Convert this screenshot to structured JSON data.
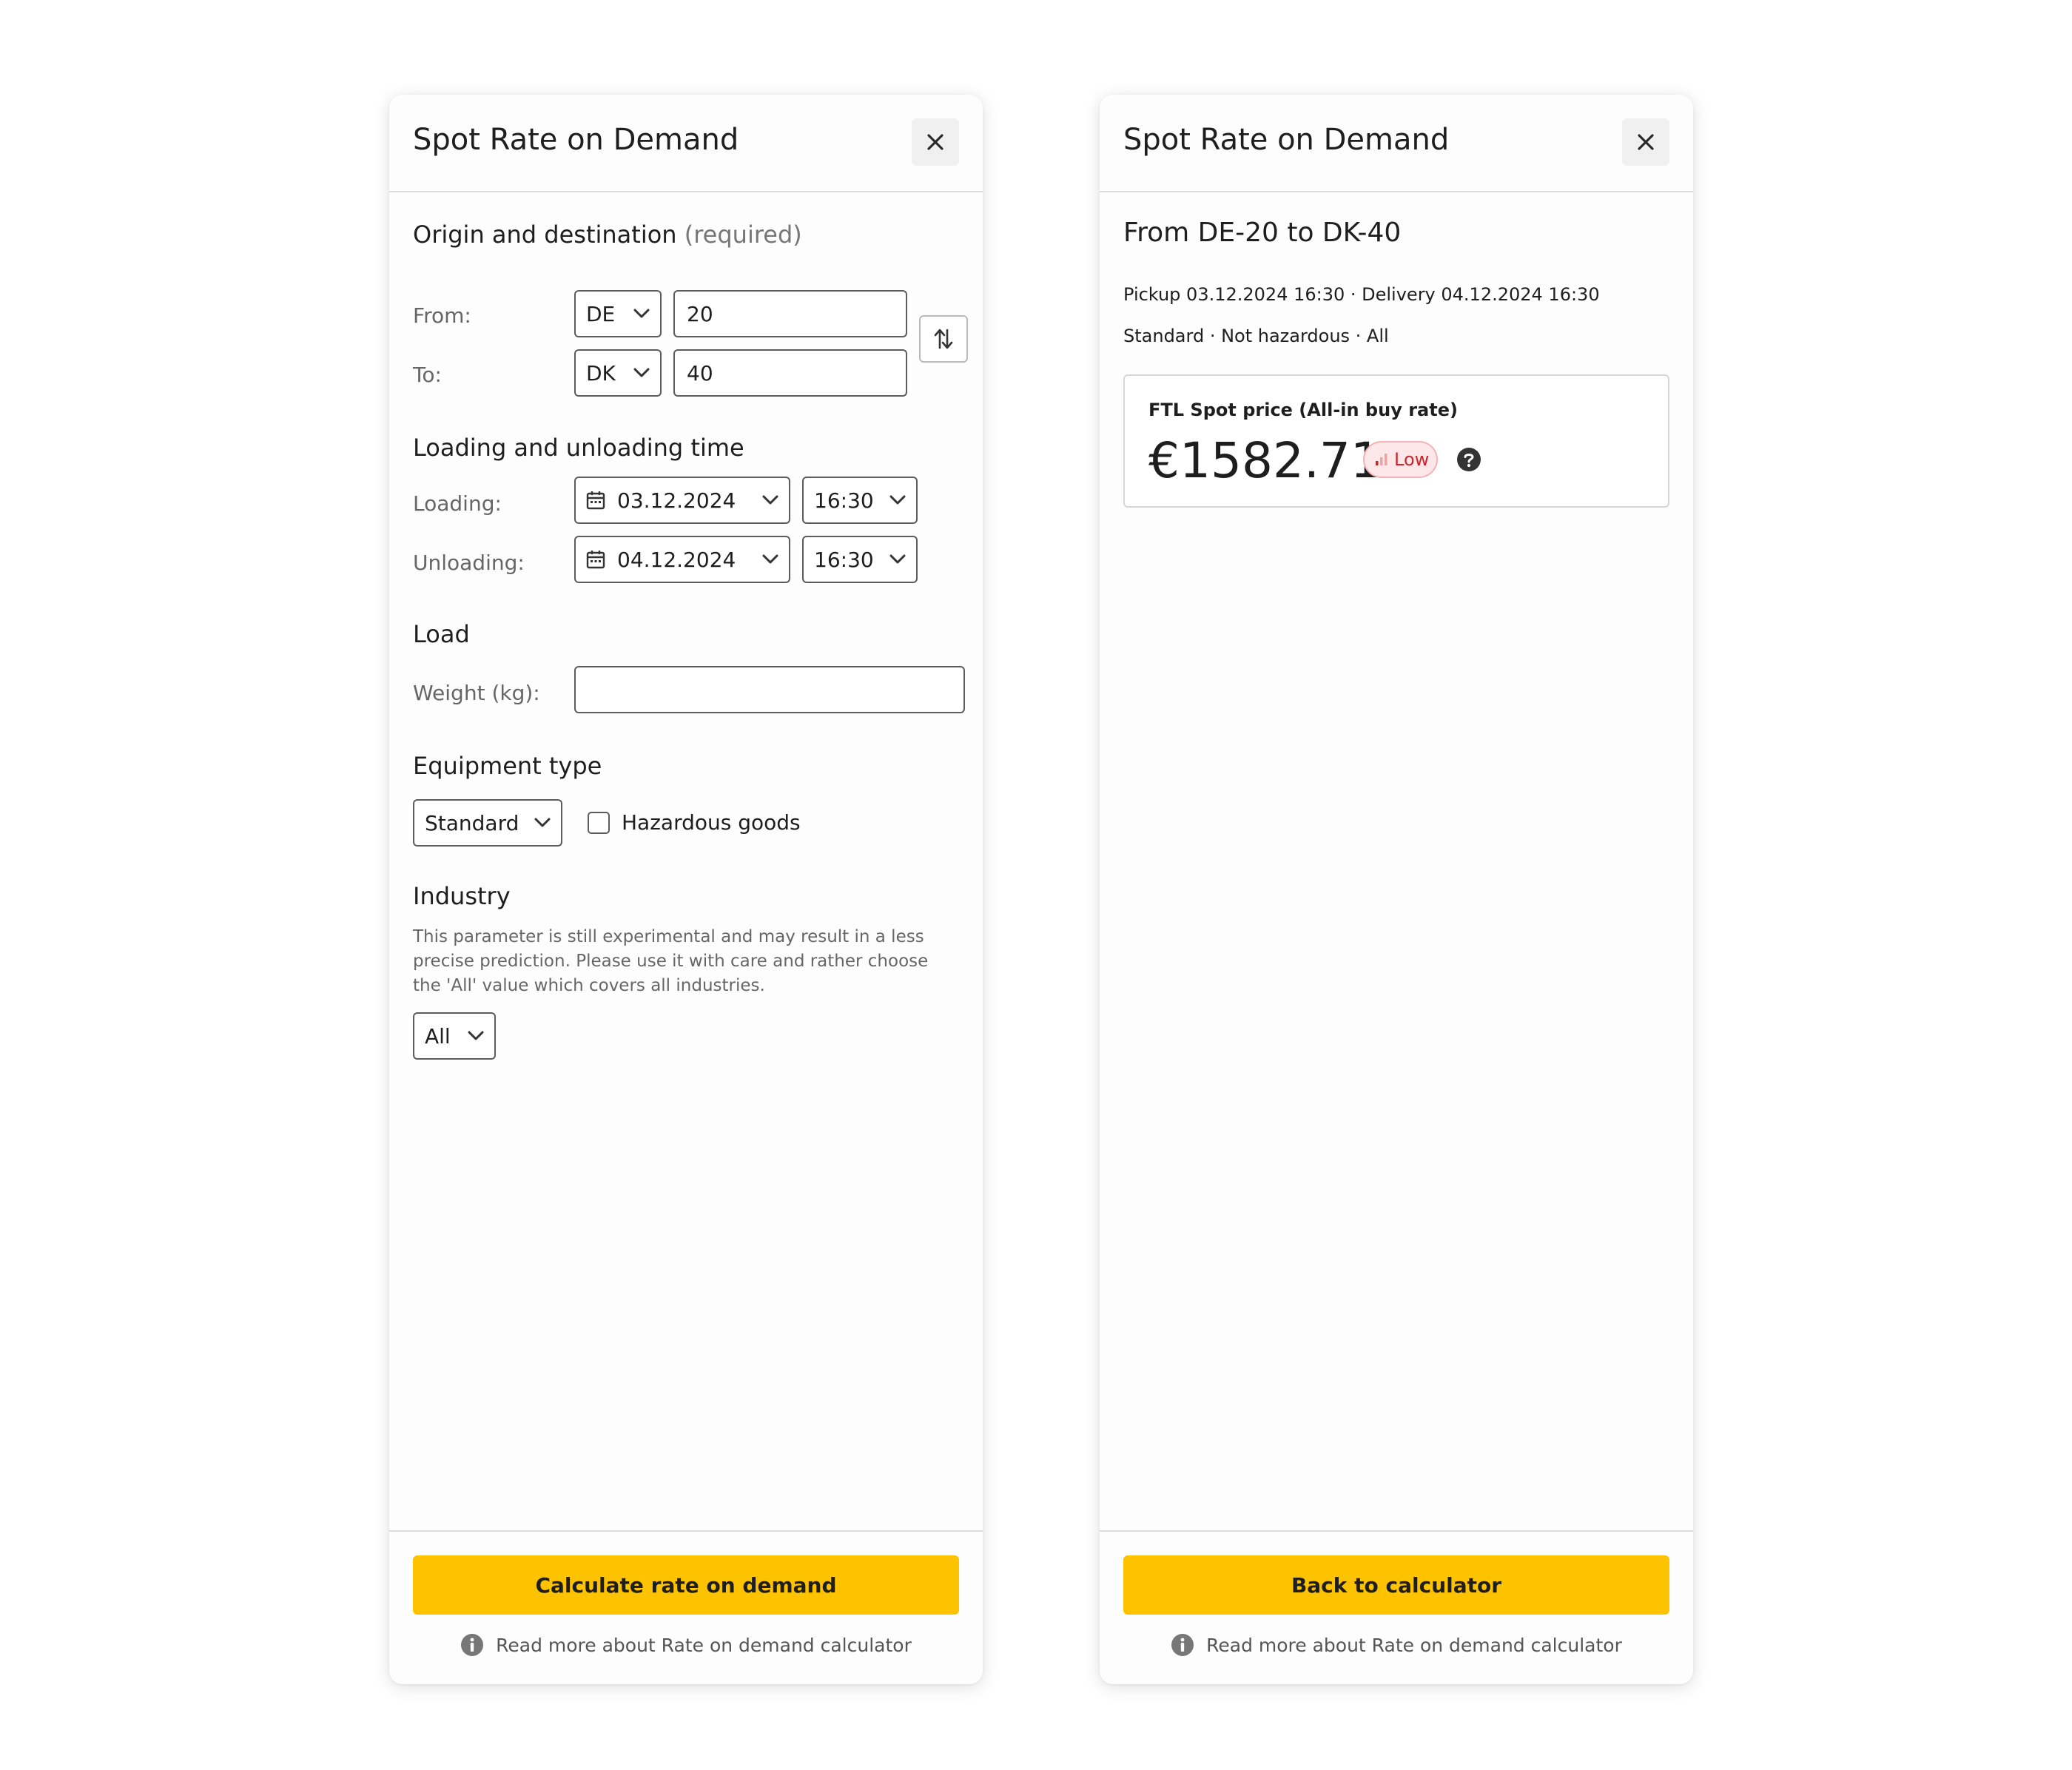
{
  "calculator": {
    "title": "Spot Rate on Demand",
    "origin_section": "Origin and destination",
    "origin_required": "(required)",
    "from_label": "From:",
    "from_country": "DE",
    "from_zip": "20",
    "to_label": "To:",
    "to_country": "DK",
    "to_zip": "40",
    "time_section": "Loading and unloading time",
    "loading_label": "Loading:",
    "loading_date": "03.12.2024",
    "loading_time": "16:30",
    "unloading_label": "Unloading:",
    "unloading_date": "04.12.2024",
    "unloading_time": "16:30",
    "load_section": "Load",
    "weight_label": "Weight (kg):",
    "weight_value": "",
    "equipment_section": "Equipment type",
    "equipment_value": "Standard",
    "hazardous_label": "Hazardous goods",
    "hazardous_checked": false,
    "industry_section": "Industry",
    "industry_description": "This parameter is still experimental and may result in a less precise prediction. Please use it with care and rather choose the 'All' value which covers all industries.",
    "industry_value": "All",
    "submit_label": "Calculate rate on demand",
    "info_link": "Read more about Rate on demand calculator"
  },
  "result": {
    "title": "Spot Rate on Demand",
    "route": "From DE-20 to DK-40",
    "schedule": "Pickup 03.12.2024 16:30 · Delivery 04.12.2024 16:30",
    "attributes": "Standard · Not hazardous · All",
    "price_label": "FTL Spot price (All-in buy rate)",
    "price": "€1582.71",
    "confidence": "Low",
    "back_label": "Back to calculator",
    "info_link": "Read more about Rate on demand calculator"
  },
  "colors": {
    "accent": "#fdc200",
    "badge_text": "#d0242c",
    "badge_bg": "#fde7e8"
  },
  "icons": [
    "close-icon",
    "chevron-down-icon",
    "swap-icon",
    "calendar-icon",
    "info-icon",
    "signal-icon",
    "help-icon"
  ]
}
